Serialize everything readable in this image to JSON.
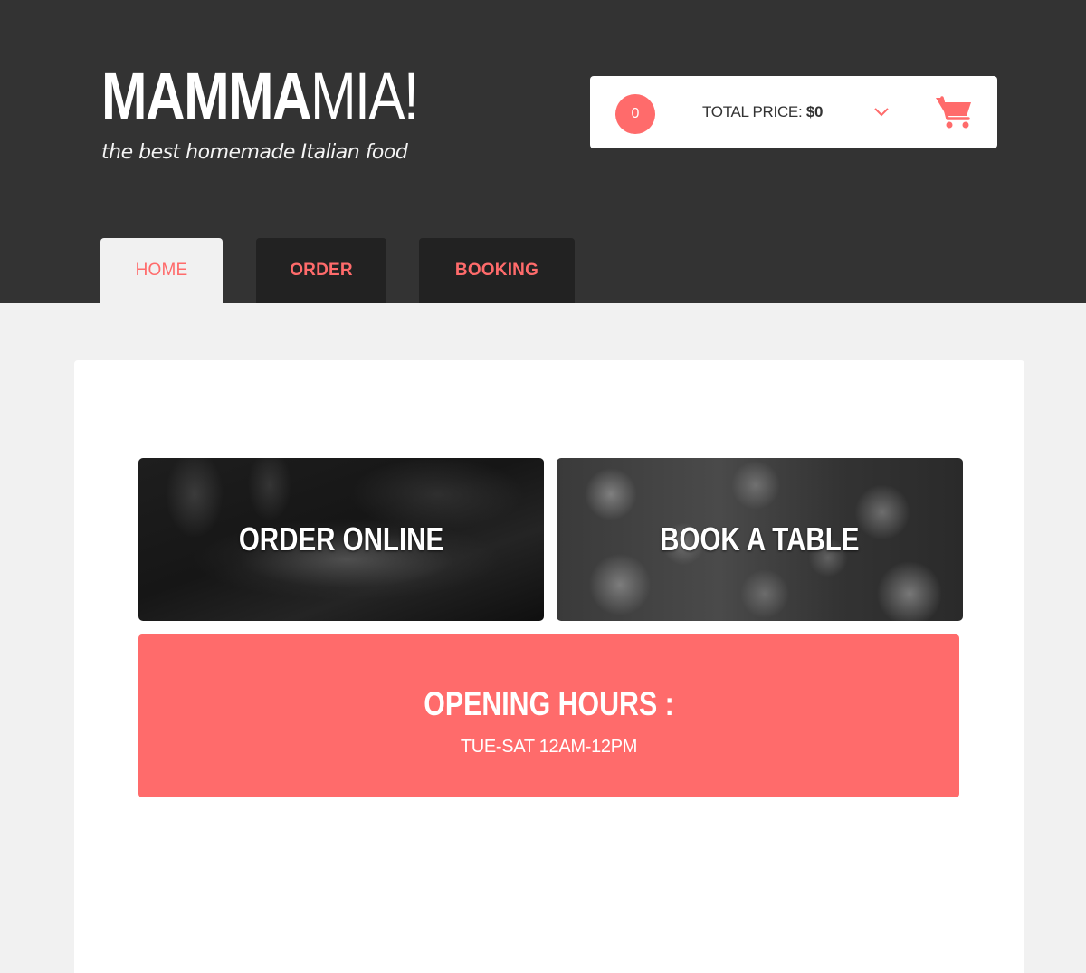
{
  "header": {
    "logo": {
      "bold": "MAMMA",
      "light": "MIA!"
    },
    "tagline": "the best homemade Italian food"
  },
  "cart": {
    "count": "0",
    "total_label": "TOTAL PRICE:",
    "total_amount": "$0",
    "icons": [
      "chevron-down-icon",
      "shopping-cart-icon"
    ]
  },
  "nav": {
    "active_tab": "home",
    "tabs": [
      {
        "id": "home",
        "label": "HOME"
      },
      {
        "id": "order",
        "label": "ORDER"
      },
      {
        "id": "booking",
        "label": "BOOKING"
      }
    ]
  },
  "main": {
    "tiles": [
      {
        "id": "order",
        "label": "ORDER ONLINE"
      },
      {
        "id": "book",
        "label": "BOOK A TABLE"
      }
    ],
    "hours": {
      "title": "OPENING HOURS :",
      "text": "TUE-SAT 12AM-12PM"
    }
  },
  "colors": {
    "accent": "#ff6b6b",
    "header_bg": "#333333",
    "tab_bg": "#222222",
    "page_bg": "#f1f1f1",
    "panel_bg": "#ffffff"
  }
}
